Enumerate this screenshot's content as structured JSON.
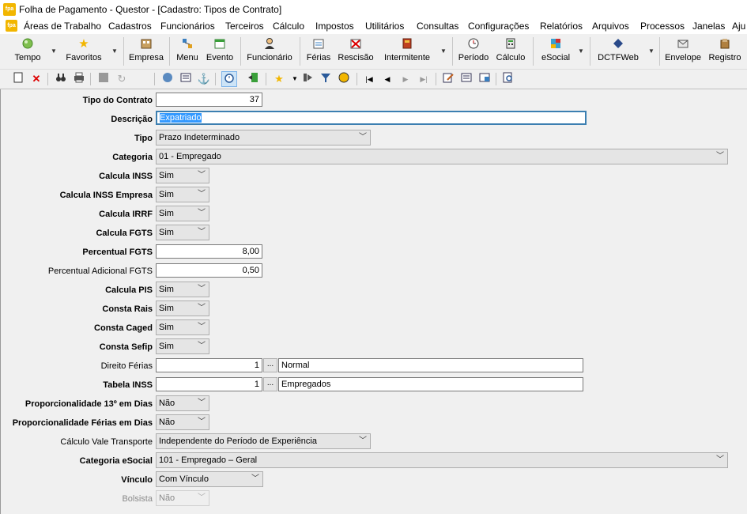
{
  "window": {
    "title": "Folha de Pagamento - Questor - [Cadastro: Tipos de Contrato]",
    "icon_text": "fpa"
  },
  "menubar": {
    "icon_text": "fpa",
    "items": [
      "Áreas de Trabalho",
      "Cadastros",
      "Funcionários",
      "Terceiros",
      "Cálculo",
      "Impostos",
      "Utilitários",
      "Consultas",
      "Configurações",
      "Relatórios",
      "Arquivos",
      "Processos",
      "Janelas",
      "Aju"
    ]
  },
  "toolbar": {
    "buttons": [
      {
        "label": "Tempo",
        "icon": "weather-icon"
      },
      {
        "label": "Favoritos",
        "icon": "star-icon"
      },
      {
        "label": "Empresa",
        "icon": "company-icon"
      },
      {
        "label": "Menu",
        "icon": "menu-icon"
      },
      {
        "label": "Evento",
        "icon": "event-icon"
      },
      {
        "label": "Funcionário",
        "icon": "employee-icon"
      },
      {
        "label": "Férias",
        "icon": "vacation-icon"
      },
      {
        "label": "Rescisão",
        "icon": "termination-icon"
      },
      {
        "label": "Intermitente",
        "icon": "intermittent-icon"
      },
      {
        "label": "Período",
        "icon": "period-icon"
      },
      {
        "label": "Cálculo",
        "icon": "calculator-icon"
      },
      {
        "label": "eSocial",
        "icon": "esocial-icon"
      },
      {
        "label": "DCTFWeb",
        "icon": "dctfweb-icon"
      },
      {
        "label": "Envelope",
        "icon": "envelope-icon"
      },
      {
        "label": "Registro",
        "icon": "register-icon"
      }
    ]
  },
  "form": {
    "tipo_contrato": {
      "label": "Tipo do Contrato",
      "value": "37"
    },
    "descricao": {
      "label": "Descrição",
      "value": "Expatriado"
    },
    "tipo": {
      "label": "Tipo",
      "value": "Prazo Indeterminado"
    },
    "categoria": {
      "label": "Categoria",
      "value": "01 - Empregado"
    },
    "calcula_inss": {
      "label": "Calcula INSS",
      "value": "Sim"
    },
    "calcula_inss_empresa": {
      "label": "Calcula INSS Empresa",
      "value": "Sim"
    },
    "calcula_irrf": {
      "label": "Calcula IRRF",
      "value": "Sim"
    },
    "calcula_fgts": {
      "label": "Calcula FGTS",
      "value": "Sim"
    },
    "percentual_fgts": {
      "label": "Percentual FGTS",
      "value": "8,00"
    },
    "percentual_adicional_fgts": {
      "label": "Percentual Adicional FGTS",
      "value": "0,50"
    },
    "calcula_pis": {
      "label": "Calcula PIS",
      "value": "Sim"
    },
    "consta_rais": {
      "label": "Consta Rais",
      "value": "Sim"
    },
    "consta_caged": {
      "label": "Consta Caged",
      "value": "Sim"
    },
    "consta_sefip": {
      "label": "Consta Sefip",
      "value": "Sim"
    },
    "direito_ferias": {
      "label": "Direito Férias",
      "value": "1",
      "description": "Normal"
    },
    "tabela_inss": {
      "label": "Tabela INSS",
      "value": "1",
      "description": "Empregados"
    },
    "prop_13": {
      "label": "Proporcionalidade 13º em Dias",
      "value": "Não"
    },
    "prop_ferias": {
      "label": "Proporcionalidade Férias em Dias",
      "value": "Não"
    },
    "calculo_vale_transporte": {
      "label": "Cálculo Vale Transporte",
      "value": "Independente do Período de Experiência"
    },
    "categoria_esocial": {
      "label": "Categoria eSocial",
      "value": "101 - Empregado – Geral"
    },
    "vinculo": {
      "label": "Vínculo",
      "value": "Com Vínculo"
    },
    "bolsista": {
      "label": "Bolsista",
      "value": "Não"
    },
    "ellipsis": "..."
  }
}
